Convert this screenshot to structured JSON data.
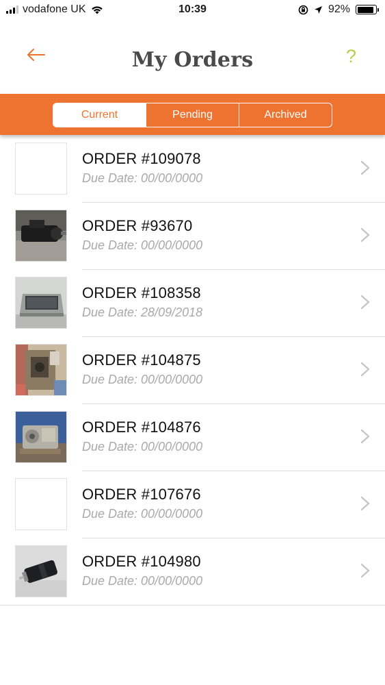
{
  "status_bar": {
    "carrier": "vodafone UK",
    "time": "10:39",
    "battery_percent": "92%",
    "battery_level": 0.92,
    "icons": [
      "signal-icon",
      "wifi-icon",
      "orientation-lock-icon",
      "location-arrow-icon",
      "battery-icon"
    ]
  },
  "header": {
    "title": "My Orders",
    "back_icon": "arrow-left-icon",
    "help_label": "?",
    "accent_color": "#ee7230",
    "help_color": "#b9cf4a"
  },
  "tabs": [
    {
      "label": "Current",
      "active": true
    },
    {
      "label": "Pending",
      "active": false
    },
    {
      "label": "Archived",
      "active": false
    }
  ],
  "orders": [
    {
      "title": "ORDER #109078",
      "due": "Due Date: 00/00/0000",
      "image": "blank"
    },
    {
      "title": "ORDER #93670",
      "due": "Due Date: 00/00/0000",
      "image": "motor-on-carpet"
    },
    {
      "title": "ORDER #108358",
      "due": "Due Date: 28/09/2018",
      "image": "display-panel"
    },
    {
      "title": "ORDER #104875",
      "due": "Due Date: 00/00/0000",
      "image": "circuit-assembly"
    },
    {
      "title": "ORDER #104876",
      "due": "Due Date: 00/00/0000",
      "image": "gear-motor"
    },
    {
      "title": "ORDER #107676",
      "due": "Due Date: 00/00/0000",
      "image": "blank"
    },
    {
      "title": "ORDER #104980",
      "due": "Due Date: 00/00/0000",
      "image": "cylinder-motor"
    }
  ]
}
